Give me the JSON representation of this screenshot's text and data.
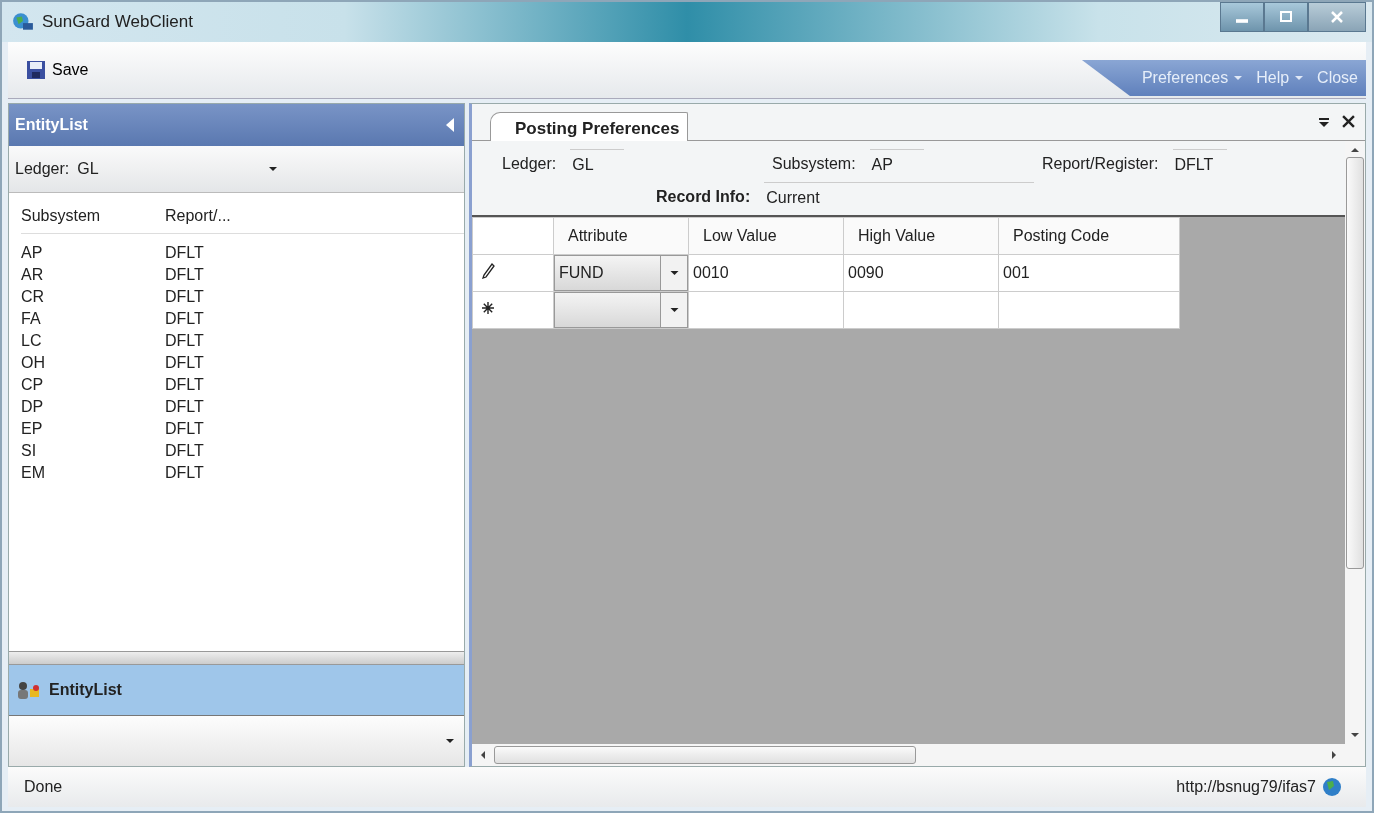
{
  "window": {
    "title": "SunGard WebClient"
  },
  "toolbar": {
    "save": "Save",
    "menus": [
      {
        "label": "Preferences",
        "dropdown": true
      },
      {
        "label": "Help",
        "dropdown": true
      },
      {
        "label": "Close",
        "dropdown": false
      }
    ]
  },
  "left_panel": {
    "title": "EntityList",
    "ledger": {
      "label": "Ledger:",
      "value": "GL"
    },
    "columns": [
      "Subsystem",
      "Report/..."
    ],
    "rows": [
      [
        "AP",
        "DFLT"
      ],
      [
        "AR",
        "DFLT"
      ],
      [
        "CR",
        "DFLT"
      ],
      [
        "FA",
        "DFLT"
      ],
      [
        "LC",
        "DFLT"
      ],
      [
        "OH",
        "DFLT"
      ],
      [
        "CP",
        "DFLT"
      ],
      [
        "DP",
        "DFLT"
      ],
      [
        "EP",
        "DFLT"
      ],
      [
        "SI",
        "DFLT"
      ],
      [
        "EM",
        "DFLT"
      ]
    ],
    "footer_title": "EntityList"
  },
  "tabs": [
    {
      "label": "Posting Preferences"
    }
  ],
  "form": {
    "fields": [
      {
        "label": "Ledger:",
        "value": "GL"
      },
      {
        "label": "Subsystem:",
        "value": "AP"
      },
      {
        "label": "Report/Register:",
        "value": "DFLT"
      }
    ],
    "record_info": {
      "label": "Record Info:",
      "value": "Current"
    }
  },
  "grid": {
    "columns": [
      "Attribute",
      "Low Value",
      "High Value",
      "Posting Code"
    ],
    "rows": [
      {
        "kind": "editing",
        "cells": [
          "FUND",
          "0010",
          "0090",
          "001"
        ]
      },
      {
        "kind": "new",
        "cells": []
      }
    ]
  },
  "status_bar": {
    "text": "Done",
    "url": "http://bsnug79/ifas7"
  }
}
